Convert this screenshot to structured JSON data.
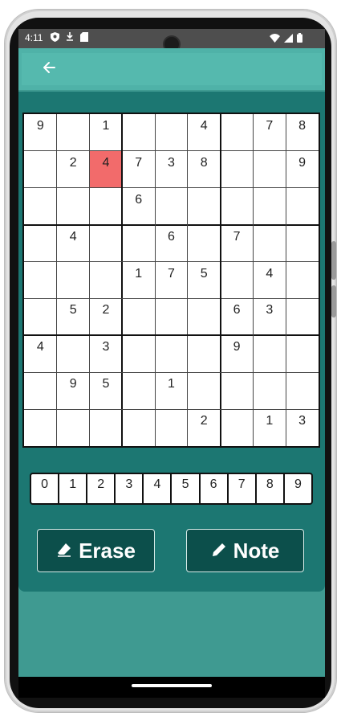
{
  "status_bar": {
    "time": "4:11"
  },
  "app_bar": {
    "back_icon": "arrow-left-icon"
  },
  "board": {
    "cells": [
      [
        "9",
        "",
        "1",
        "",
        "",
        "4",
        "",
        "7",
        "8"
      ],
      [
        "",
        "2",
        "4",
        "7",
        "3",
        "8",
        "",
        "",
        "9"
      ],
      [
        "",
        "",
        "",
        "6",
        "",
        "",
        "",
        "",
        ""
      ],
      [
        "",
        "4",
        "",
        "",
        "6",
        "",
        "7",
        "",
        ""
      ],
      [
        "",
        "",
        "",
        "1",
        "7",
        "5",
        "",
        "4",
        ""
      ],
      [
        "",
        "5",
        "2",
        "",
        "",
        "",
        "6",
        "3",
        ""
      ],
      [
        "4",
        "",
        "3",
        "",
        "",
        "",
        "9",
        "",
        ""
      ],
      [
        "",
        "9",
        "5",
        "",
        "1",
        "",
        "",
        "",
        ""
      ],
      [
        "",
        "",
        "",
        "",
        "",
        "2",
        "",
        "1",
        "3"
      ]
    ],
    "selected_cell": {
      "row": 1,
      "col": 2
    }
  },
  "number_buttons": [
    "0",
    "1",
    "2",
    "3",
    "4",
    "5",
    "6",
    "7",
    "8",
    "9"
  ],
  "actions": {
    "erase_label": "Erase",
    "note_label": "Note"
  },
  "colors": {
    "app_bar": "#4fb2a8",
    "panel": "#1c7772",
    "screen_bg": "#3f9a91",
    "buttons": "#0c4f4b",
    "highlight": "#f26b6b"
  }
}
